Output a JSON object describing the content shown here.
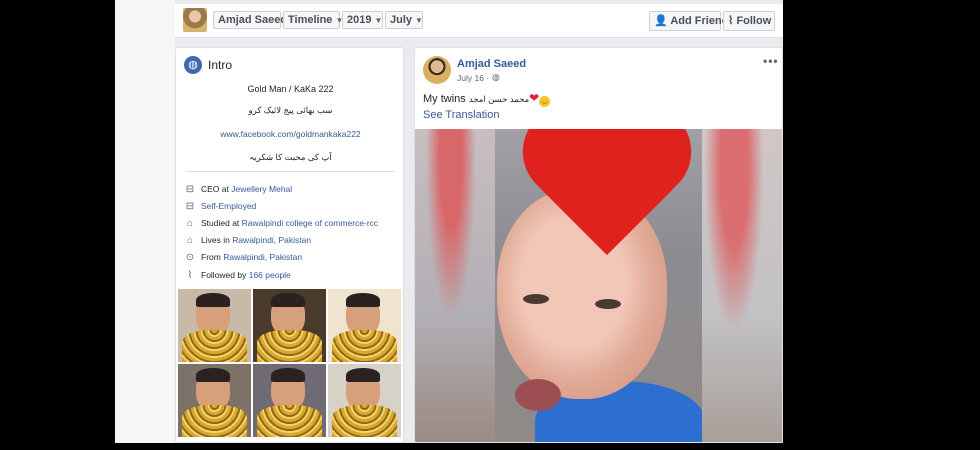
{
  "topbar": {
    "profile_name": "Amjad Saeed",
    "timeline_label": "Timeline",
    "year_label": "2019",
    "month_label": "July",
    "add_friend_label": "Add Friend",
    "follow_label": "Follow"
  },
  "intro": {
    "title": "Intro",
    "bio_lines": [
      "Gold Man / KaKa 222",
      "سب بھائی پیج لائیک کرو",
      "www.facebook.com/goldmankaka222",
      "آپ کی محبت کا شکریہ"
    ],
    "details": [
      {
        "icon": "briefcase-icon",
        "prefix": "CEO at ",
        "link": "Jewellery Mehal"
      },
      {
        "icon": "briefcase-icon",
        "prefix": "",
        "link": "Self-Employed"
      },
      {
        "icon": "graduation-cap-icon",
        "prefix": "Studied at ",
        "link": "Rawalpindi college of commerce-rcc"
      },
      {
        "icon": "home-icon",
        "prefix": "Lives in ",
        "link": "Rawalpindi, Pakistan"
      },
      {
        "icon": "location-pin-icon",
        "prefix": "From ",
        "link": "Rawalpindi, Pakistan"
      },
      {
        "icon": "rss-icon",
        "prefix": "Followed by ",
        "link": "166 people"
      }
    ]
  },
  "post": {
    "author": "Amjad Saeed",
    "date": "July 16 ·",
    "text": "My twins",
    "text_urdu": "محمد حسن امجد",
    "see_translation": "See Translation"
  },
  "colors": {
    "link": "#385898",
    "accent": "#4267b2",
    "heart": "#e0221f"
  }
}
